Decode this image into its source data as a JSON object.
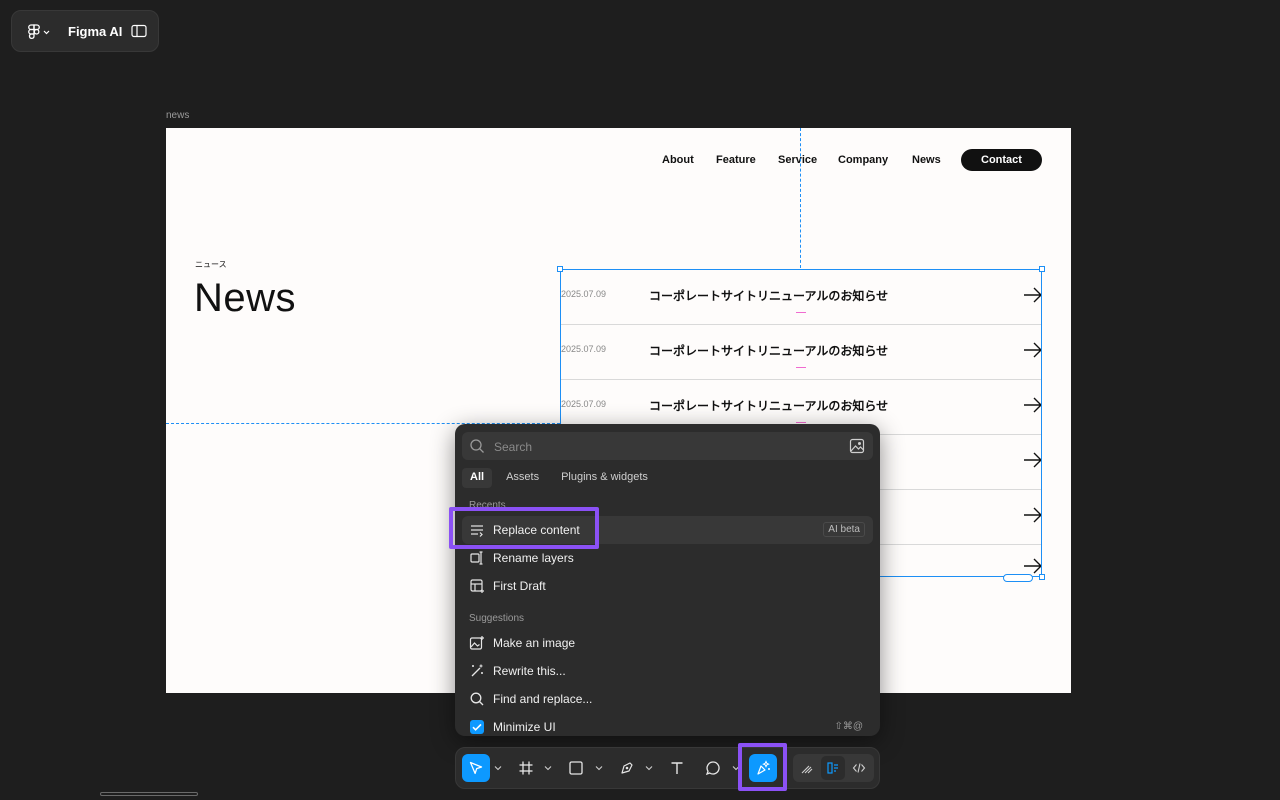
{
  "app": {
    "name": "Figma AI"
  },
  "frame": {
    "label": "news"
  },
  "site": {
    "nav": [
      "About",
      "Feature",
      "Service",
      "Company",
      "News"
    ],
    "contact": "Contact",
    "kicker": "ニュース",
    "heading": "News",
    "news_items": [
      {
        "date": "2025.07.09",
        "title": "コーポレートサイトリニューアルのお知らせ"
      },
      {
        "date": "2025.07.09",
        "title": "コーポレートサイトリニューアルのお知らせ"
      },
      {
        "date": "2025.07.09",
        "title": "コーポレートサイトリニューアルのお知らせ"
      },
      {
        "date": "",
        "title": ""
      },
      {
        "date": "",
        "title": ""
      },
      {
        "date": "",
        "title": ""
      }
    ]
  },
  "quick_actions": {
    "search_placeholder": "Search",
    "tabs": [
      "All",
      "Assets",
      "Plugins & widgets"
    ],
    "recents_label": "Recents",
    "recents": [
      {
        "label": "Replace content",
        "badge": "AI beta",
        "icon": "replace-content-icon"
      },
      {
        "label": "Rename layers",
        "icon": "rename-layers-icon"
      },
      {
        "label": "First Draft",
        "icon": "first-draft-icon"
      }
    ],
    "suggestions_label": "Suggestions",
    "suggestions": [
      {
        "label": "Make an image",
        "icon": "make-image-icon"
      },
      {
        "label": "Rewrite this...",
        "icon": "magic-wand-icon"
      },
      {
        "label": "Find and replace...",
        "icon": "search-icon"
      },
      {
        "label": "Minimize UI",
        "shortcut": "⇧⌘@",
        "icon": "checkbox-icon",
        "checked": true
      }
    ]
  },
  "toolbar": {
    "tools": [
      "move-tool",
      "frame-tool",
      "rectangle-tool",
      "pen-tool",
      "text-tool",
      "comment-tool",
      "actions-ai-tool"
    ],
    "modes": [
      "draw-mode",
      "design-mode",
      "dev-mode"
    ]
  },
  "colors": {
    "accent": "#0d99ff",
    "highlight": "#8b51f5",
    "selection": "#1d8ff5",
    "marker": "#f06bd0"
  }
}
